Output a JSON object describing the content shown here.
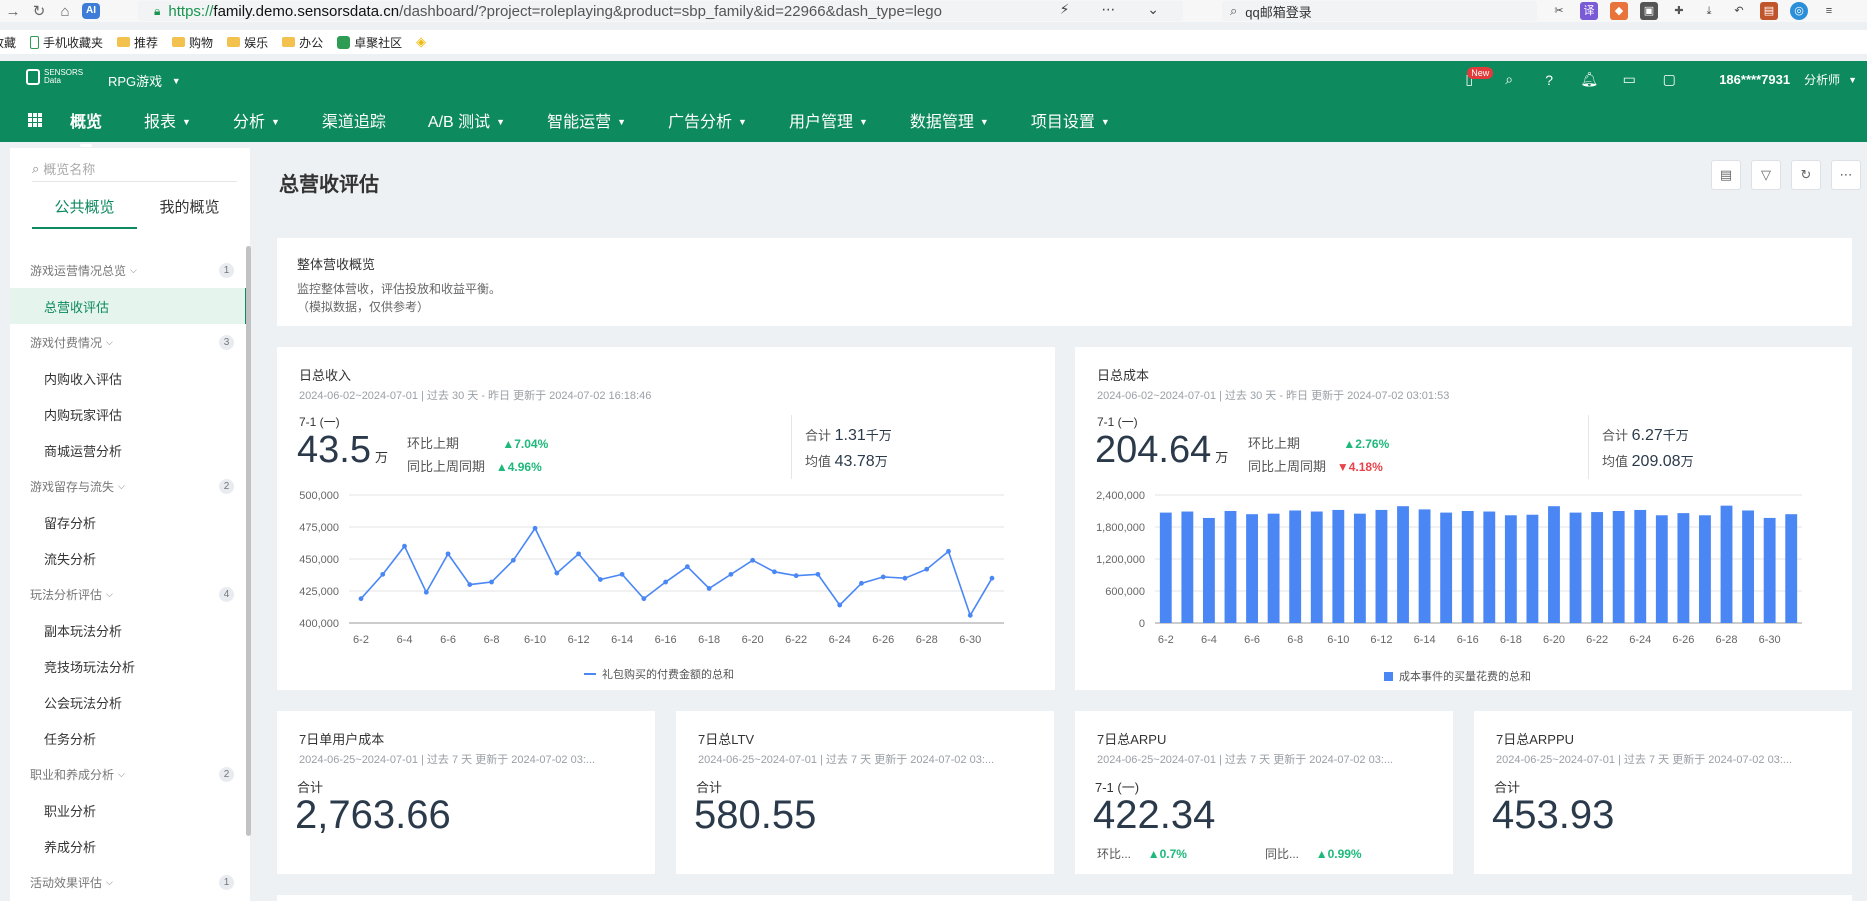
{
  "browser": {
    "url_proto": "https://",
    "url_host": "family.demo.sensorsdata.cn",
    "url_path": "/dashboard/?project=roleplaying&product=sbp_family&id=22966&dash_type=lego",
    "search_text": "qq邮箱登录"
  },
  "bookmarks": [
    "收藏",
    "手机收藏夹",
    "推荐",
    "购物",
    "娱乐",
    "办公",
    "卓聚社区"
  ],
  "header": {
    "logo_line1": "SENSORS",
    "logo_line2": "Data",
    "project": "RPG游戏",
    "new_badge": "New",
    "phone": "186****7931",
    "role": "分析师"
  },
  "nav": [
    "概览",
    "报表",
    "分析",
    "渠道追踪",
    "A/B 测试",
    "智能运营",
    "广告分析",
    "用户管理",
    "数据管理",
    "项目设置"
  ],
  "sidebar": {
    "search_placeholder": "概览名称",
    "tabs": [
      "公共概览",
      "我的概览"
    ],
    "groups": [
      {
        "name": "游戏运营情况总览",
        "count": "1",
        "items": [
          "总营收评估"
        ]
      },
      {
        "name": "游戏付费情况",
        "count": "3",
        "items": [
          "内购收入评估",
          "内购玩家评估",
          "商城运营分析"
        ]
      },
      {
        "name": "游戏留存与流失",
        "count": "2",
        "items": [
          "留存分析",
          "流失分析"
        ]
      },
      {
        "name": "玩法分析评估",
        "count": "4",
        "items": [
          "副本玩法分析",
          "竞技场玩法分析",
          "公会玩法分析",
          "任务分析"
        ]
      },
      {
        "name": "职业和养成分析",
        "count": "2",
        "items": [
          "职业分析",
          "养成分析"
        ]
      },
      {
        "name": "活动效果评估",
        "count": "1",
        "items": []
      }
    ]
  },
  "page": {
    "title": "总营收评估",
    "intro_title": "整体营收概览",
    "intro_line1": "监控整体营收，评估投放和收益平衡。",
    "intro_line2": "（模拟数据，仅供参考）"
  },
  "revenue": {
    "title": "日总收入",
    "meta": "2024-06-02~2024-07-01 | 过去 30 天 - 昨日 更新于 2024-07-02 16:18:46",
    "date": "7-1 (一)",
    "value": "43.5",
    "unit": "万",
    "cmp1_label": "环比上期",
    "cmp1_value": "▲7.04%",
    "cmp2_label": "同比上周同期",
    "cmp2_value": "▲4.96%",
    "total_label": "合计",
    "total_value": "1.31",
    "total_unit": "千万",
    "avg_label": "均值",
    "avg_value": "43.78",
    "avg_unit": "万",
    "legend": "礼包购买的付费金额的总和"
  },
  "cost": {
    "title": "日总成本",
    "meta": "2024-06-02~2024-07-01 | 过去 30 天 - 昨日 更新于 2024-07-02 03:01:53",
    "date": "7-1 (一)",
    "value": "204.64",
    "unit": "万",
    "cmp1_label": "环比上期",
    "cmp1_value": "▲2.76%",
    "cmp2_label": "同比上周同期",
    "cmp2_value": "▼4.18%",
    "total_label": "合计",
    "total_value": "6.27",
    "total_unit": "千万",
    "avg_label": "均值",
    "avg_value": "209.08",
    "avg_unit": "万",
    "legend": "成本事件的买量花费的总和"
  },
  "kpis": [
    {
      "title": "7日单用户成本",
      "meta": "2024-06-25~2024-07-01 | 过去 7 天 更新于 2024-07-02 03:...",
      "label": "合计",
      "value": "2,763.66"
    },
    {
      "title": "7日总LTV",
      "meta": "2024-06-25~2024-07-01 | 过去 7 天 更新于 2024-07-02 03:...",
      "label": "合计",
      "value": "580.55"
    },
    {
      "title": "7日总ARPU",
      "meta": "2024-06-25~2024-07-01 | 过去 7 天 更新于 2024-07-02 03:...",
      "label": "7-1 (一)",
      "value": "422.34",
      "cmp1_label": "环比...",
      "cmp1_value": "▲0.7%",
      "cmp2_label": "同比...",
      "cmp2_value": "▲0.99%"
    },
    {
      "title": "7日总ARPPU",
      "meta": "2024-06-25~2024-07-01 | 过去 7 天 更新于 2024-07-02 03:...",
      "label": "合计",
      "value": "453.93"
    }
  ],
  "colors": {
    "brand": "#0e8a5f",
    "series": "#4a87f5",
    "up": "#1cb97a",
    "down": "#e8434b"
  },
  "chart_data": [
    {
      "type": "line",
      "x": [
        "6-2",
        "6-3",
        "6-4",
        "6-5",
        "6-6",
        "6-7",
        "6-8",
        "6-9",
        "6-10",
        "6-11",
        "6-12",
        "6-13",
        "6-14",
        "6-15",
        "6-16",
        "6-17",
        "6-18",
        "6-19",
        "6-20",
        "6-21",
        "6-22",
        "6-23",
        "6-24",
        "6-25",
        "6-26",
        "6-27",
        "6-28",
        "6-29",
        "6-30",
        "7-1"
      ],
      "tick_labels": [
        "6-2",
        "6-4",
        "6-6",
        "6-8",
        "6-10",
        "6-12",
        "6-14",
        "6-16",
        "6-18",
        "6-20",
        "6-22",
        "6-24",
        "6-26",
        "6-28",
        "6-30"
      ],
      "series": [
        {
          "name": "礼包购买的付费金额的总和",
          "values": [
            419000,
            438000,
            460000,
            424000,
            454000,
            430000,
            432000,
            449000,
            474000,
            439000,
            454000,
            434000,
            438000,
            419000,
            432000,
            444000,
            427000,
            438000,
            449000,
            440000,
            437000,
            438000,
            414000,
            431000,
            436000,
            435000,
            442000,
            456000,
            406000,
            435000
          ]
        }
      ],
      "ylim": [
        400000,
        500000
      ],
      "yticks": [
        "500,000",
        "475,000",
        "450,000",
        "425,000",
        "400,000"
      ],
      "grid": true,
      "legend": "bottom-center"
    },
    {
      "type": "bar",
      "x": [
        "6-2",
        "6-3",
        "6-4",
        "6-5",
        "6-6",
        "6-7",
        "6-8",
        "6-9",
        "6-10",
        "6-11",
        "6-12",
        "6-13",
        "6-14",
        "6-15",
        "6-16",
        "6-17",
        "6-18",
        "6-19",
        "6-20",
        "6-21",
        "6-22",
        "6-23",
        "6-24",
        "6-25",
        "6-26",
        "6-27",
        "6-28",
        "6-29",
        "6-30",
        "7-1"
      ],
      "tick_labels": [
        "6-2",
        "6-4",
        "6-6",
        "6-8",
        "6-10",
        "6-12",
        "6-14",
        "6-16",
        "6-18",
        "6-20",
        "6-22",
        "6-24",
        "6-26",
        "6-28",
        "6-30"
      ],
      "series": [
        {
          "name": "成本事件的买量花费的总和",
          "values": [
            2070000,
            2090000,
            1970000,
            2100000,
            2040000,
            2050000,
            2110000,
            2090000,
            2120000,
            2050000,
            2120000,
            2190000,
            2130000,
            2070000,
            2100000,
            2090000,
            2020000,
            2030000,
            2190000,
            2070000,
            2080000,
            2100000,
            2120000,
            2020000,
            2060000,
            2020000,
            2200000,
            2110000,
            1970000,
            2040000
          ]
        }
      ],
      "ylim": [
        0,
        2400000
      ],
      "yticks": [
        "2,400,000",
        "1,800,000",
        "1,200,000",
        "600,000",
        "0"
      ],
      "grid": true,
      "legend": "bottom-center"
    }
  ]
}
